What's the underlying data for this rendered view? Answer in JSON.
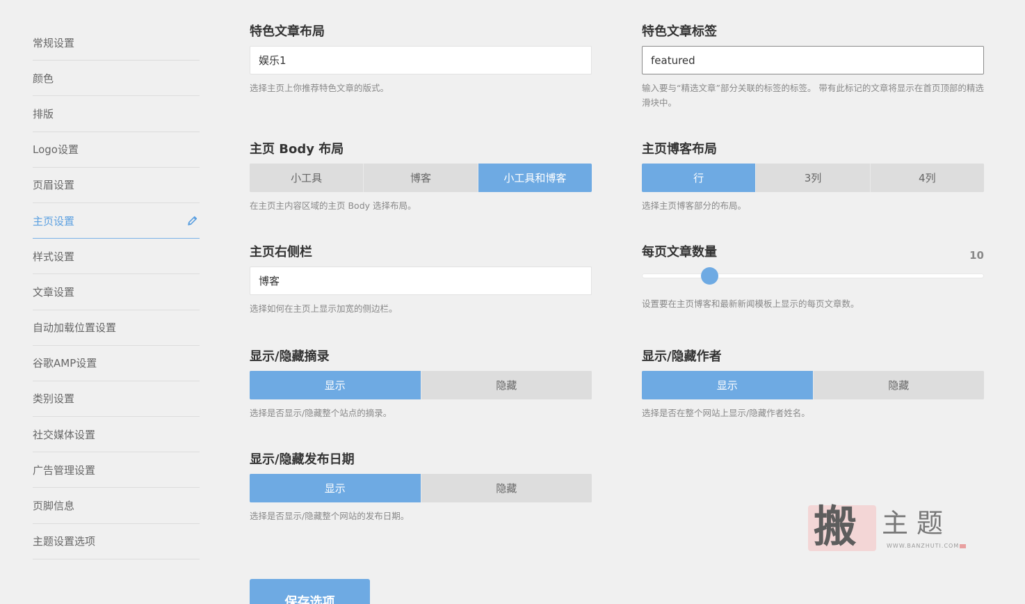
{
  "sidebar": {
    "items": [
      {
        "label": "常规设置"
      },
      {
        "label": "颜色"
      },
      {
        "label": "排版"
      },
      {
        "label": "Logo设置"
      },
      {
        "label": "页眉设置"
      },
      {
        "label": "主页设置",
        "active": true
      },
      {
        "label": "样式设置"
      },
      {
        "label": "文章设置"
      },
      {
        "label": "自动加载位置设置"
      },
      {
        "label": "谷歌AMP设置"
      },
      {
        "label": "类别设置"
      },
      {
        "label": "社交媒体设置"
      },
      {
        "label": "广告管理设置"
      },
      {
        "label": "页脚信息"
      },
      {
        "label": "主题设置选项"
      }
    ],
    "edit_icon": "pencil-icon"
  },
  "featured_layout": {
    "title": "特色文章布局",
    "value": "娱乐1",
    "desc": "选择主页上你推荐特色文章的版式。"
  },
  "featured_tag": {
    "title": "特色文章标签",
    "value": "featured",
    "desc": "输入要与“精选文章”部分关联的标签的标签。 带有此标记的文章将显示在首页顶部的精选滑块中。"
  },
  "body_layout": {
    "title": "主页 Body 布局",
    "options": [
      "小工具",
      "博客",
      "小工具和博客"
    ],
    "selected": 2,
    "desc": "在主页主内容区域的主页 Body 选择布局。"
  },
  "blog_layout": {
    "title": "主页博客布局",
    "options": [
      "行",
      "3列",
      "4列"
    ],
    "selected": 0,
    "desc": "选择主页博客部分的布局。"
  },
  "right_sidebar": {
    "title": "主页右侧栏",
    "value": "博客",
    "desc": "选择如何在主页上显示加宽的侧边栏。"
  },
  "posts_per_page": {
    "title": "每页文章数量",
    "value": "10",
    "slider_fraction": 0.18,
    "desc": "设置要在主页博客和最新新闻模板上显示的每页文章数。"
  },
  "excerpt_toggle": {
    "title": "显示/隐藏摘录",
    "options": [
      "显示",
      "隐藏"
    ],
    "selected": 0,
    "desc": "选择是否显示/隐藏整个站点的摘录。"
  },
  "author_toggle": {
    "title": "显示/隐藏作者",
    "options": [
      "显示",
      "隐藏"
    ],
    "selected": 0,
    "desc": "选择是否在整个网站上显示/隐藏作者姓名。"
  },
  "date_toggle": {
    "title": "显示/隐藏发布日期",
    "options": [
      "显示",
      "隐藏"
    ],
    "selected": 0,
    "desc": "选择是否显示/隐藏整个网站的发布日期。"
  },
  "save_label": "保存选项",
  "watermark": {
    "big": "搬",
    "small": "主题",
    "url": "WWW.BANZHUTI.COM"
  },
  "colors": {
    "accent": "#6eaae3",
    "active_nav": "#5a9fe0",
    "background": "#f0f0f0"
  }
}
